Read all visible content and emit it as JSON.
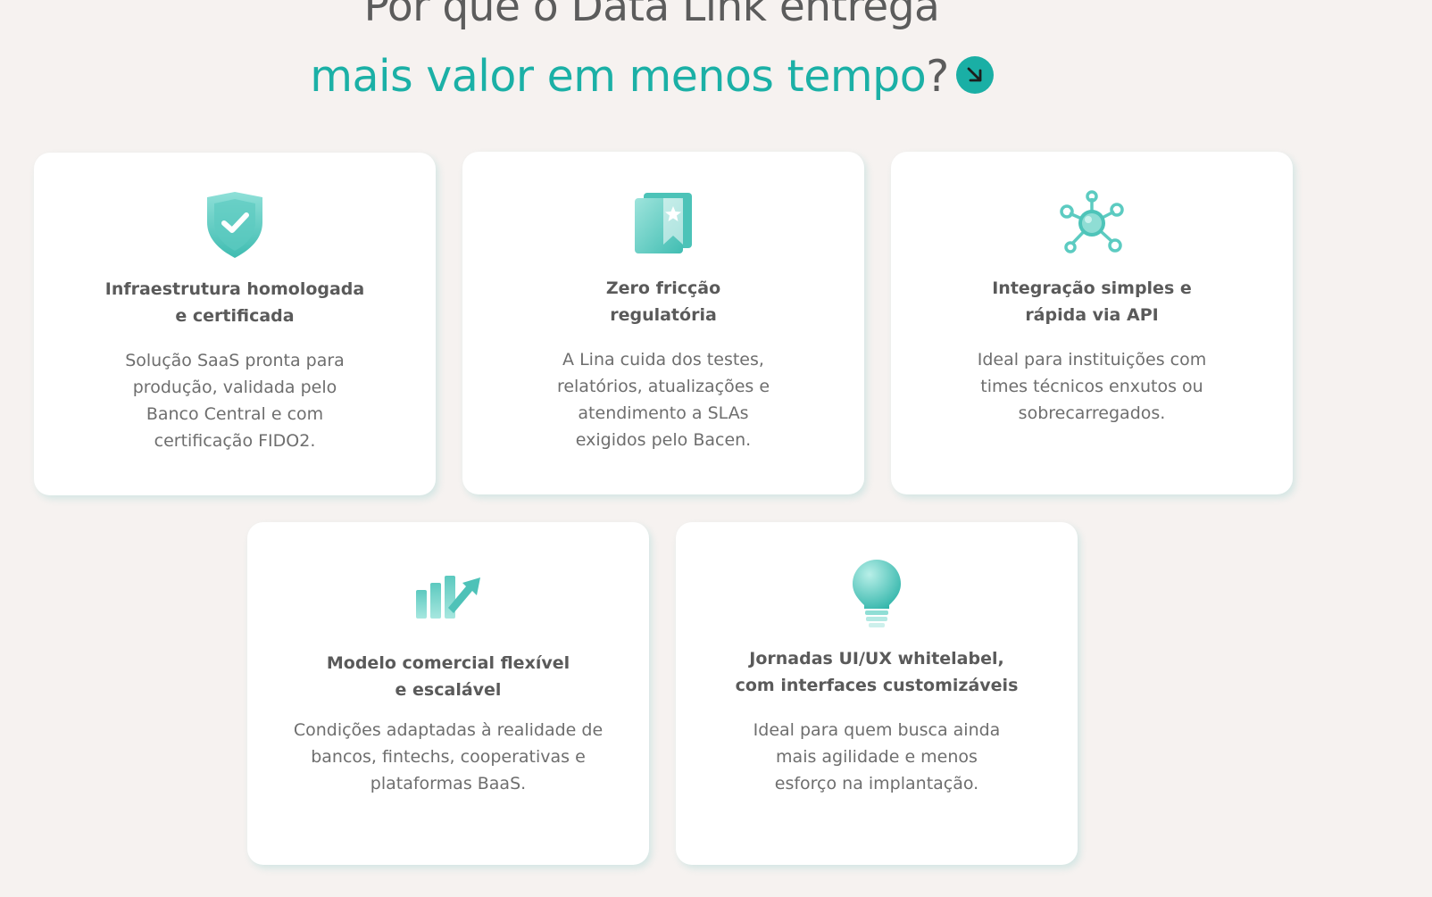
{
  "heading": {
    "line1": "Por que o Data Link entrega",
    "line2": "mais valor em menos tempo",
    "question_mark": "?"
  },
  "accent_color": "#1bb0a6",
  "cards": [
    {
      "icon": "shield-check-icon",
      "title": "Infraestrutura homologada\ne certificada",
      "description": "Solução SaaS pronta para\nprodução, validada pelo\nBanco Central e com\ncertificação FIDO2."
    },
    {
      "icon": "bookmark-star-icon",
      "title": "Zero fricção\nregulatória",
      "description": "A Lina cuida dos testes,\nrelatórios, atualizações e\natendimento a SLAs\nexigidos pelo Bacen."
    },
    {
      "icon": "network-hub-icon",
      "title": "Integração simples e\nrápida via API",
      "description": "Ideal para instituições com\ntimes técnicos enxutos ou\nsobrecarregados."
    },
    {
      "icon": "growth-chart-icon",
      "title": "Modelo comercial flexível\ne escalável",
      "description": "Condições adaptadas à realidade de\nbancos, fintechs, cooperativas e\nplataformas BaaS."
    },
    {
      "icon": "lightbulb-icon",
      "title": "Jornadas UI/UX whitelabel,\ncom interfaces customizáveis",
      "description": "Ideal para quem busca ainda\nmais agilidade e menos\nesforço na implantação."
    }
  ]
}
